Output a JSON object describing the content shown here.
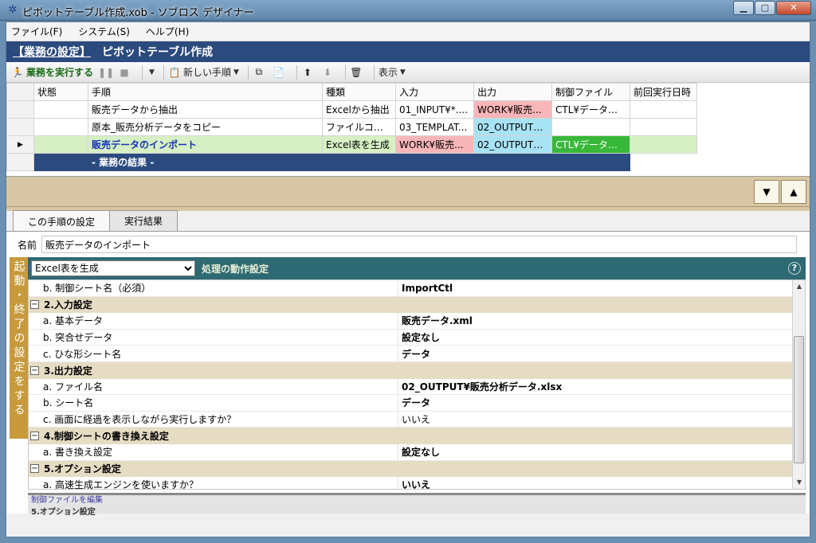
{
  "window": {
    "title": "ピボットテーブル作成.xob - ソブロス デザイナー"
  },
  "menu": [
    "ファイル(F)",
    "システム(S)",
    "ヘルプ(H)"
  ],
  "banner": {
    "crumb": "【業務の設定】",
    "title": "ピボットテーブル作成"
  },
  "toolbar": {
    "run": "業務を実行する",
    "new_step": "新しい手順",
    "view": "表示"
  },
  "grid": {
    "columns": [
      "状態",
      "手順",
      "種類",
      "入力",
      "出力",
      "制御ファイル",
      "前回実行日時"
    ],
    "rows": [
      {
        "state": "",
        "step": "販売データから抽出",
        "kind": "Excelから抽出",
        "input": "01_INPUT¥*....",
        "output": "WORK¥販売...",
        "ctl": "CTL¥データ抽...",
        "last": ""
      },
      {
        "state": "",
        "step": "原本_販売分析データをコピー",
        "kind": "ファイルコピー",
        "input": "03_TEMPLAT...",
        "output": "02_OUTPUT¥...",
        "ctl": "",
        "last": ""
      },
      {
        "state": "",
        "step": "販売データのインポート",
        "kind": "Excel表を生成",
        "input": "WORK¥販売...",
        "output": "02_OUTPUT¥...",
        "ctl": "CTL¥データ生...",
        "last": ""
      }
    ],
    "result_label": "- 業務の結果 -"
  },
  "tabs": [
    "この手順の設定",
    "実行結果"
  ],
  "name_field": {
    "label": "名前",
    "value": "販売データのインポート"
  },
  "side_tab": "起動・終了の設定をする",
  "section": {
    "selected_type": "Excel表を生成",
    "title": "処理の動作設定"
  },
  "props": [
    {
      "type": "row",
      "key": "b. 制御シート名（必須）",
      "value": "ImportCtl",
      "bold": true
    },
    {
      "type": "cat",
      "label": "2.入力設定"
    },
    {
      "type": "row",
      "key": "a. 基本データ",
      "value": "販売データ.xml",
      "bold": true
    },
    {
      "type": "row",
      "key": "b. 突合せデータ",
      "value": "設定なし",
      "bold": true
    },
    {
      "type": "row",
      "key": "c. ひな形シート名",
      "value": "データ",
      "bold": true
    },
    {
      "type": "cat",
      "label": "3.出力設定"
    },
    {
      "type": "row",
      "key": "a. ファイル名",
      "value": "02_OUTPUT¥販売分析データ.xlsx",
      "bold": true
    },
    {
      "type": "row",
      "key": "b. シート名",
      "value": "データ",
      "bold": true
    },
    {
      "type": "row",
      "key": "c. 画面に経過を表示しながら実行しますか？",
      "value": "いいえ",
      "bold": false
    },
    {
      "type": "cat",
      "label": "4.制御シートの書き換え設定"
    },
    {
      "type": "row",
      "key": "a. 書き換え設定",
      "value": "設定なし",
      "bold": true
    },
    {
      "type": "cat",
      "label": "5.オプション設定"
    },
    {
      "type": "row",
      "key": "a. 高速生成エンジンを使いますか？",
      "value": "いいえ",
      "bold": true
    }
  ],
  "bottom": {
    "link": "制御ファイルを編集",
    "label": "5.オプション設定"
  }
}
